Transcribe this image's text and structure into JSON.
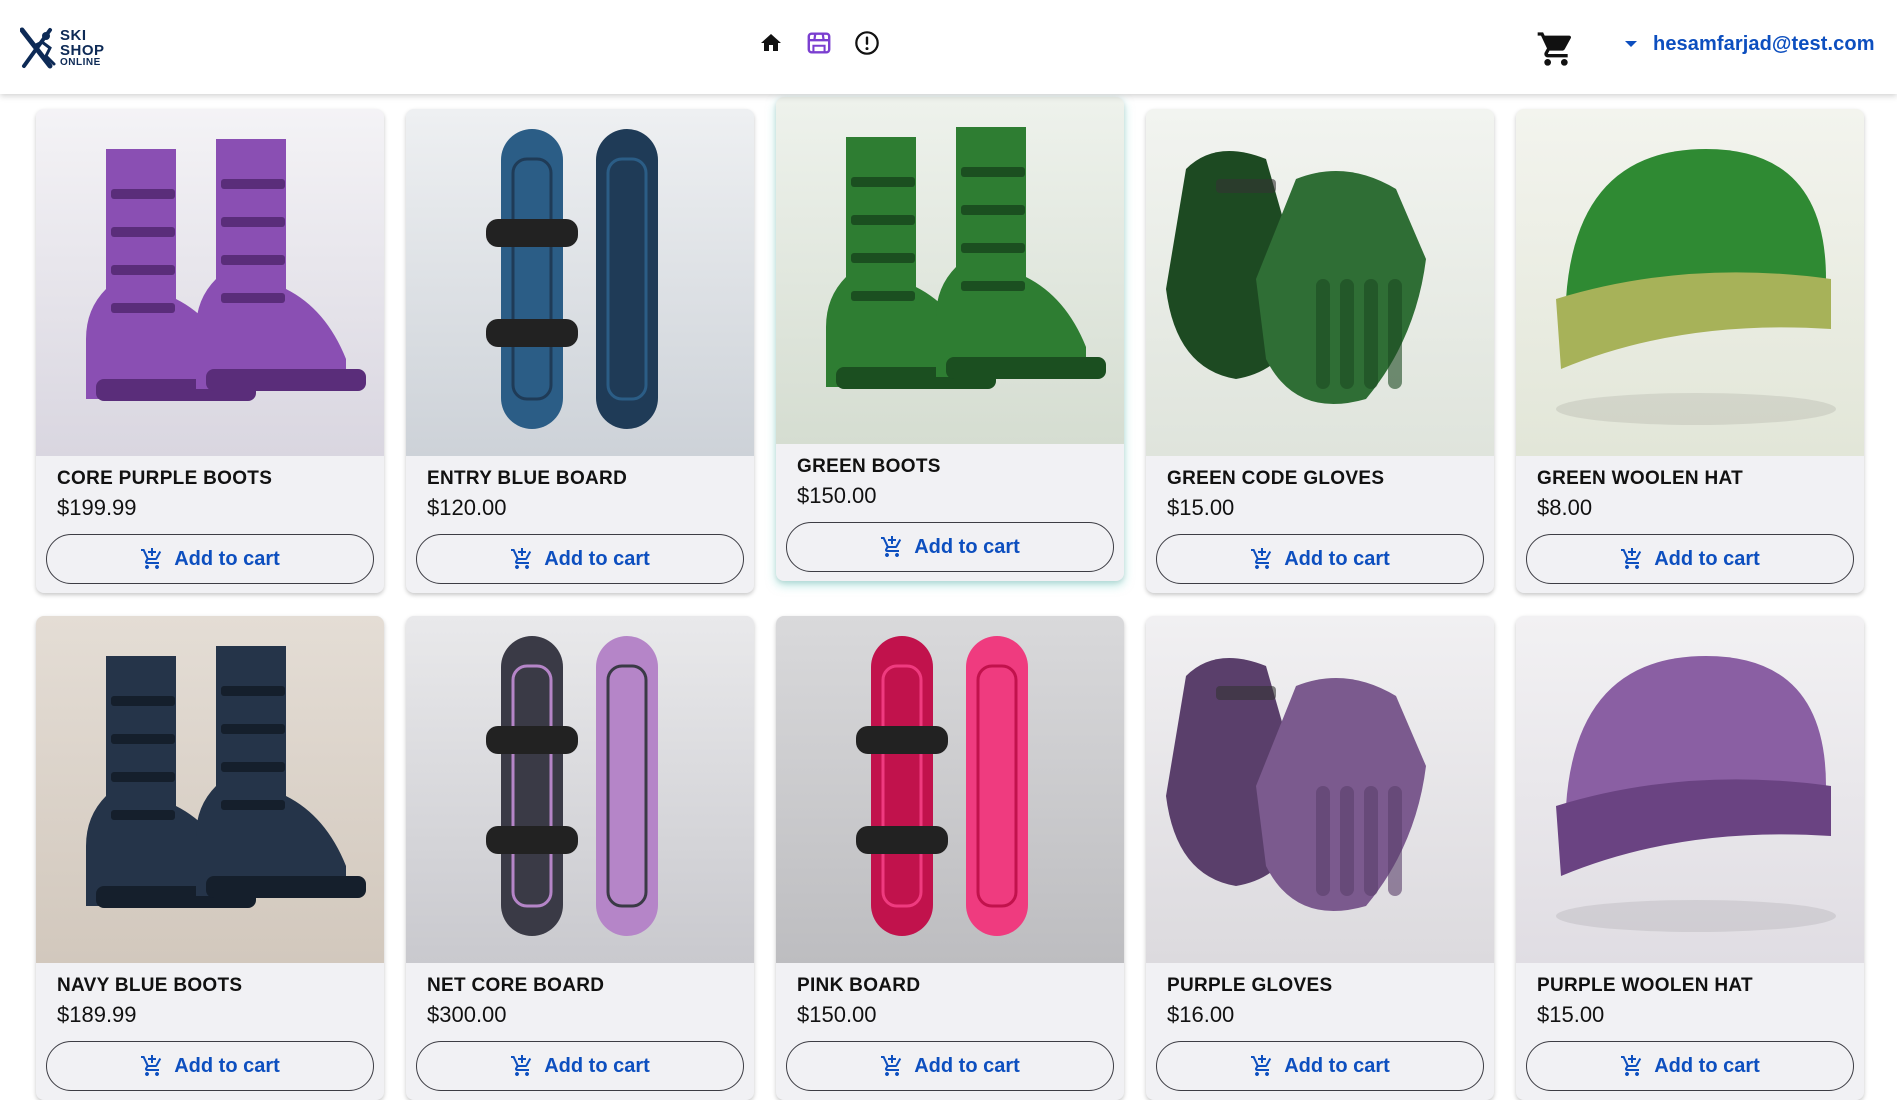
{
  "header": {
    "logo_line1": "SKI",
    "logo_line2": "SHOP",
    "logo_line3": "ONLINE",
    "nav": [
      {
        "name": "home-icon"
      },
      {
        "name": "store-icon"
      },
      {
        "name": "alert-icon"
      }
    ],
    "cart_icon": "cart-icon",
    "user_email": "hesamfarjad@test.com"
  },
  "products": [
    {
      "name": "CORE PURPLE BOOTS",
      "price": "$199.99",
      "button": "Add to cart"
    },
    {
      "name": "ENTRY BLUE BOARD",
      "price": "$120.00",
      "button": "Add to cart"
    },
    {
      "name": "GREEN BOOTS",
      "price": "$150.00",
      "button": "Add to cart"
    },
    {
      "name": "GREEN CODE GLOVES",
      "price": "$15.00",
      "button": "Add to cart"
    },
    {
      "name": "GREEN WOOLEN HAT",
      "price": "$8.00",
      "button": "Add to cart"
    },
    {
      "name": "NAVY BLUE BOOTS",
      "price": "$189.99",
      "button": "Add to cart"
    },
    {
      "name": "NET CORE BOARD",
      "price": "$300.00",
      "button": "Add to cart"
    },
    {
      "name": "PINK BOARD",
      "price": "$150.00",
      "button": "Add to cart"
    },
    {
      "name": "PURPLE GLOVES",
      "price": "$16.00",
      "button": "Add to cart"
    },
    {
      "name": "PURPLE WOOLEN HAT",
      "price": "$15.00",
      "button": "Add to cart"
    }
  ],
  "colors": {
    "accent": "#0d4fbf",
    "store_icon": "#7b3fd0",
    "card_bg": "#f1f1f4"
  }
}
